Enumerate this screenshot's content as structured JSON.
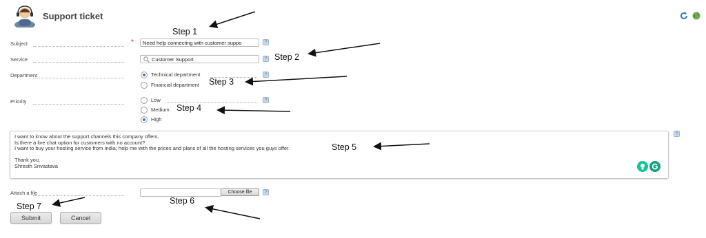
{
  "header": {
    "title": "Support ticket"
  },
  "form": {
    "subject": {
      "label": "Subject",
      "value": "Need help connecting with customer suppo"
    },
    "service": {
      "label": "Service",
      "value": "Customer Support"
    },
    "department": {
      "label": "Department",
      "options": [
        "Technical department",
        "Financial department"
      ],
      "selected": "Technical department"
    },
    "priority": {
      "label": "Priority",
      "options": [
        "Low",
        "Medium",
        "High"
      ],
      "selected": "High"
    },
    "message": {
      "lines": [
        "I want to know about the support channels this company offers.",
        "Is there a live chat option for customers with no account?",
        "I want to buy your hosting service from India; help me with the prices and plans of all the hosting services you guys offer.",
        "",
        "Thank you,",
        "Shresth Srivastava"
      ]
    },
    "attach": {
      "label": "Attach a file",
      "button": "Choose file"
    },
    "help_mark": "?",
    "submit_label": "Submit",
    "cancel_label": "Cancel"
  },
  "annotations": {
    "steps": [
      "Step 1",
      "Step 2",
      "Step 3",
      "Step 4",
      "Step 5",
      "Step 6",
      "Step 7"
    ]
  },
  "colors": {
    "required": "#e02020",
    "accent": "#4a74b0",
    "grammarly": "#15c39a"
  },
  "icons": [
    "support-agent-icon",
    "refresh-icon",
    "globe-icon",
    "search-icon",
    "lightbulb-icon",
    "grammarly-icon"
  ]
}
